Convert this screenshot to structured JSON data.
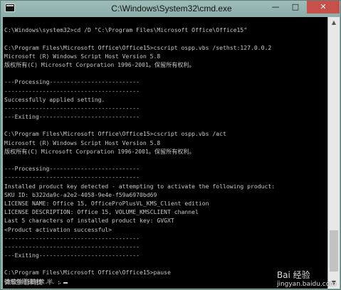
{
  "window": {
    "title": "C:\\Windows\\System32\\cmd.exe",
    "icon": "cmd-icon",
    "controls": {
      "minimize": "—",
      "maximize": "□",
      "close": "✕"
    }
  },
  "console": {
    "lines": [
      "",
      "C:\\Windows\\system32>cd /D \"C:\\Program Files\\Microsoft Office\\Office15\"",
      "",
      "C:\\Program Files\\Microsoft Office\\Office15>cscript ospp.vbs /sethst:127.0.0.2",
      "Microsoft (R) Windows Script Host Version 5.8",
      "版权所有(C) Microsoft Corporation 1996-2001。保留所有权利。",
      "",
      "---Processing--------------------------",
      "---------------------------------------",
      "Successfully applied setting.",
      "---------------------------------------",
      "---Exiting-----------------------------",
      "",
      "C:\\Program Files\\Microsoft Office\\Office15>cscript ospp.vbs /act",
      "Microsoft (R) Windows Script Host Version 5.8",
      "版权所有(C) Microsoft Corporation 1996-2001。保留所有权利。",
      "",
      "---Processing--------------------------",
      "---------------------------------------",
      "Installed product key detected - attempting to activate the following product:",
      "SKU ID: b322da9c-a2e2-4058-9e4e-f59a6970bd69",
      "LICENSE NAME: Office 15, OfficeProPlusVL_KMS_Client edition",
      "LICENSE DESCRIPTION: Office 15, VOLUME_KMSCLIENT channel",
      "Last 5 characters of installed product key: GVGXT",
      "<Product activation successful>",
      "---------------------------------------",
      "---------------------------------------",
      "---Exiting-----------------------------",
      "",
      "C:\\Program Files\\Microsoft Office\\Office15>pause",
      "请按任意键继续. . ."
    ],
    "ime_status": "微软拼音简捷 半 :"
  },
  "watermark": {
    "brand": "Bai 经验",
    "url": "jingyan.baidu.com"
  }
}
